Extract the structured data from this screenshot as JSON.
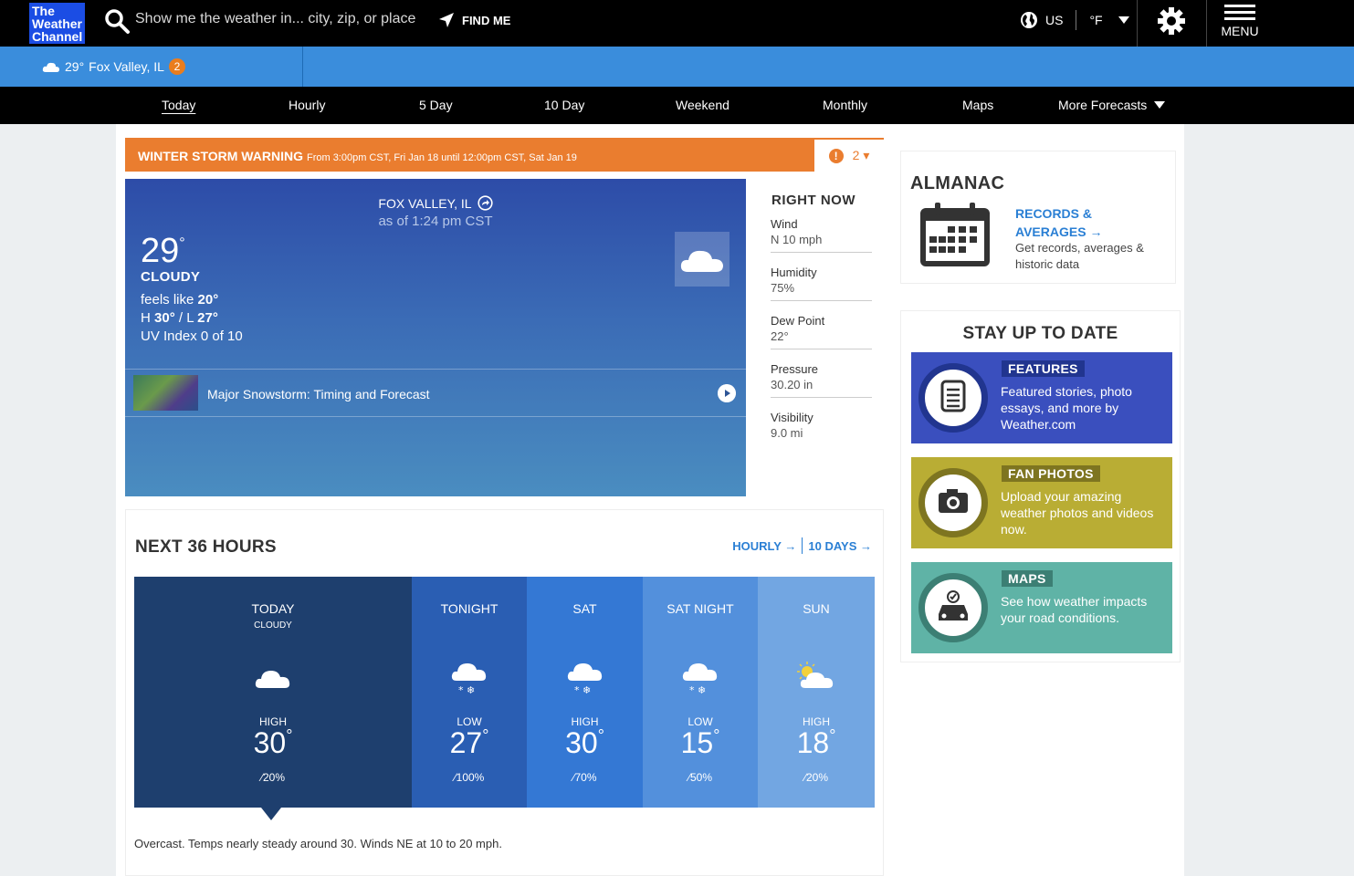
{
  "header": {
    "logo": "The Weather Channel",
    "search_placeholder": "Show me the weather in... city, zip, or place",
    "find_me": "FIND ME",
    "region": "US",
    "unit": "°F",
    "menu": "MENU"
  },
  "location_bar": {
    "temp": "29°",
    "place": "Fox Valley, IL",
    "alerts": "2"
  },
  "nav": [
    {
      "label": "Today",
      "active": true
    },
    {
      "label": "Hourly"
    },
    {
      "label": "5 Day"
    },
    {
      "label": "10 Day"
    },
    {
      "label": "Weekend"
    },
    {
      "label": "Monthly"
    },
    {
      "label": "Maps"
    },
    {
      "label": "More Forecasts"
    }
  ],
  "alert": {
    "title": "WINTER STORM WARNING",
    "detail": "From 3:00pm CST, Fri Jan 18 until 12:00pm CST, Sat Jan 19",
    "count": "2"
  },
  "current": {
    "place": "FOX VALLEY, IL",
    "as_of": "as of 1:24 pm CST",
    "temp": "29",
    "condition": "CLOUDY",
    "feels_like_label": "feels like ",
    "feels_like": "20",
    "high_label": "H ",
    "high": "30",
    "low_label": " / L ",
    "low": "27",
    "uv": "UV Index 0 of 10",
    "video_title": "Major Snowstorm: Timing and Forecast"
  },
  "right_now": {
    "title": "RIGHT NOW",
    "items": [
      {
        "label": "Wind",
        "value": "N 10 mph"
      },
      {
        "label": "Humidity",
        "value": "75%"
      },
      {
        "label": "Dew Point",
        "value": "22°"
      },
      {
        "label": "Pressure",
        "value": "30.20 in"
      },
      {
        "label": "Visibility",
        "value": "9.0 mi"
      }
    ]
  },
  "next36": {
    "title": "NEXT 36 HOURS",
    "link_hourly": "HOURLY",
    "link_10days": "10 DAYS",
    "periods": [
      {
        "name": "TODAY",
        "cond": "CLOUDY",
        "icon": "cloud-icon",
        "hl": "HIGH",
        "temp": "30",
        "precip": "20%",
        "color": "#1e3f6e"
      },
      {
        "name": "TONIGHT",
        "cond": "",
        "icon": "snow-cloud-icon",
        "hl": "LOW",
        "temp": "27",
        "precip": "100%",
        "color": "#2a5eb3"
      },
      {
        "name": "SAT",
        "cond": "",
        "icon": "snow-cloud-icon",
        "hl": "HIGH",
        "temp": "30",
        "precip": "70%",
        "color": "#3478d4"
      },
      {
        "name": "SAT NIGHT",
        "cond": "",
        "icon": "snow-cloud-icon",
        "hl": "LOW",
        "temp": "15",
        "precip": "50%",
        "color": "#5390dc"
      },
      {
        "name": "SUN",
        "cond": "",
        "icon": "partly-sunny-icon",
        "hl": "HIGH",
        "temp": "18",
        "precip": "20%",
        "color": "#72a6e2"
      }
    ],
    "description": "Overcast. Temps nearly steady around 30. Winds NE at 10 to 20 mph."
  },
  "almanac": {
    "title": "ALMANAC",
    "link_line1": "RECORDS &",
    "link_line2": "AVERAGES",
    "sub": "Get records, averages & historic data"
  },
  "stay": {
    "title": "STAY UP TO DATE",
    "cards": [
      {
        "tag": "FEATURES",
        "text": "Featured stories, photo essays, and more by Weather.com",
        "color": "#3a4fbe",
        "icon": "article-icon"
      },
      {
        "tag": "FAN PHOTOS",
        "text": "Upload your amazing weather photos and videos now.",
        "color": "#b9ad34",
        "icon": "camera-icon"
      },
      {
        "tag": "MAPS",
        "text": "See how weather impacts your road conditions.",
        "color": "#5fb3a6",
        "icon": "car-icon"
      }
    ]
  }
}
